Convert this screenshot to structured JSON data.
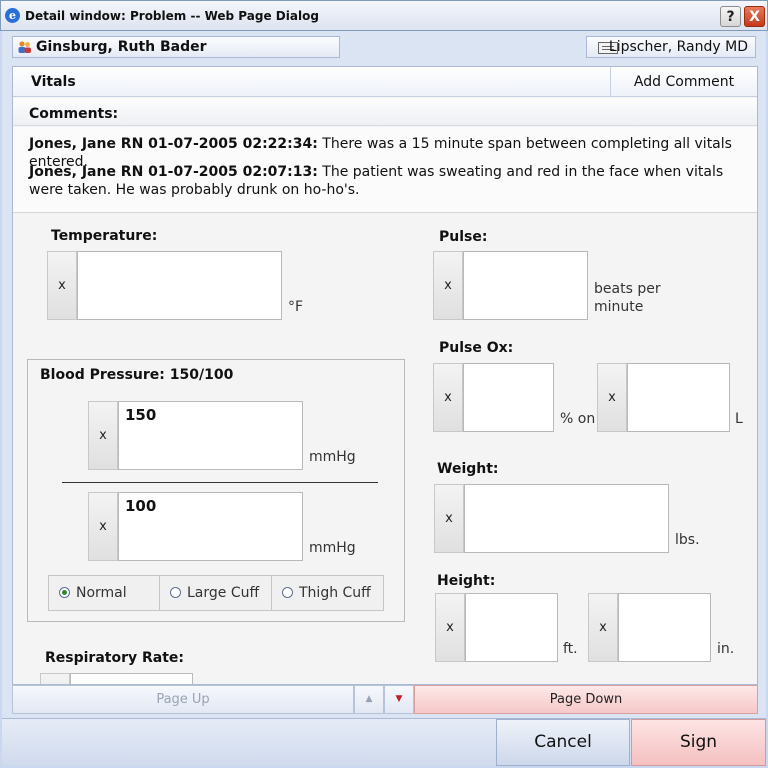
{
  "window": {
    "title": "Detail window: Problem -- Web Page Dialog",
    "help_label": "?",
    "close_label": "X"
  },
  "header": {
    "patient_name": "Ginsburg, Ruth Bader",
    "provider_name": "Lipscher, Randy MD"
  },
  "tabs": {
    "vitals": "Vitals",
    "add_comment": "Add Comment"
  },
  "comments": {
    "label": "Comments:",
    "items": [
      {
        "author": "Jones, Jane RN 01-07-2005 02:22:34:",
        "text": " There was a 15 minute span between completing all vitals entered."
      },
      {
        "author": "Jones, Jane RN 01-07-2005 02:07:13:",
        "text": " The patient was sweating and red in the face when vitals were taken. He was probably drunk on ho-ho's."
      }
    ]
  },
  "fields": {
    "clear_label": "x",
    "temperature": {
      "label": "Temperature:",
      "value": "",
      "unit": "°F"
    },
    "pulse": {
      "label": "Pulse:",
      "value": "",
      "unit": "beats per minute"
    },
    "pulse_ox": {
      "label": "Pulse Ox:",
      "value1": "",
      "unit1": "% on",
      "value2": "",
      "unit2": "L"
    },
    "weight": {
      "label": "Weight:",
      "value": "",
      "unit": "lbs."
    },
    "height": {
      "label": "Height:",
      "ft_value": "",
      "ft_unit": "ft.",
      "in_value": "",
      "in_unit": "in."
    },
    "blood_pressure": {
      "label": "Blood Pressure: 150/100",
      "systolic": "150",
      "diastolic": "100",
      "unit": "mmHg",
      "cuff_options": [
        "Normal",
        "Large Cuff",
        "Thigh Cuff"
      ],
      "cuff_selected": "Normal"
    },
    "respiratory_rate": {
      "label": "Respiratory Rate:",
      "value": ""
    }
  },
  "pager": {
    "page_up": "Page Up",
    "arrow_up": "▲",
    "arrow_down": "▼",
    "page_down": "Page Down"
  },
  "footer": {
    "cancel": "Cancel",
    "sign": "Sign"
  }
}
